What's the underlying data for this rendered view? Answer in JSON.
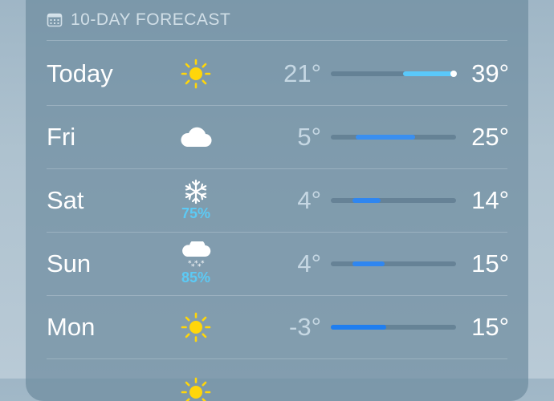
{
  "header": {
    "title": "10-DAY FORECAST",
    "icon": "calendar-icon"
  },
  "rows": [
    {
      "day": "Today",
      "icon": "sun-icon",
      "precip": "",
      "low": "21°",
      "high": "39°",
      "range_start": 0.58,
      "range_end": 0.98,
      "current": 0.98,
      "color": "#5ac8fa"
    },
    {
      "day": "Fri",
      "icon": "cloud-icon",
      "precip": "",
      "low": "5°",
      "high": "25°",
      "range_start": 0.2,
      "range_end": 0.67,
      "current": null,
      "color": "#3a8ff0"
    },
    {
      "day": "Sat",
      "icon": "snowflake-icon",
      "precip": "75%",
      "low": "4°",
      "high": "14°",
      "range_start": 0.17,
      "range_end": 0.4,
      "current": null,
      "color": "#2f86f0"
    },
    {
      "day": "Sun",
      "icon": "cloud-snow-icon",
      "precip": "85%",
      "low": "4°",
      "high": "15°",
      "range_start": 0.17,
      "range_end": 0.43,
      "current": null,
      "color": "#2f86f0"
    },
    {
      "day": "Mon",
      "icon": "sun-icon",
      "precip": "",
      "low": "-3°",
      "high": "15°",
      "range_start": 0.0,
      "range_end": 0.44,
      "current": null,
      "color": "#1f7ef0"
    }
  ]
}
